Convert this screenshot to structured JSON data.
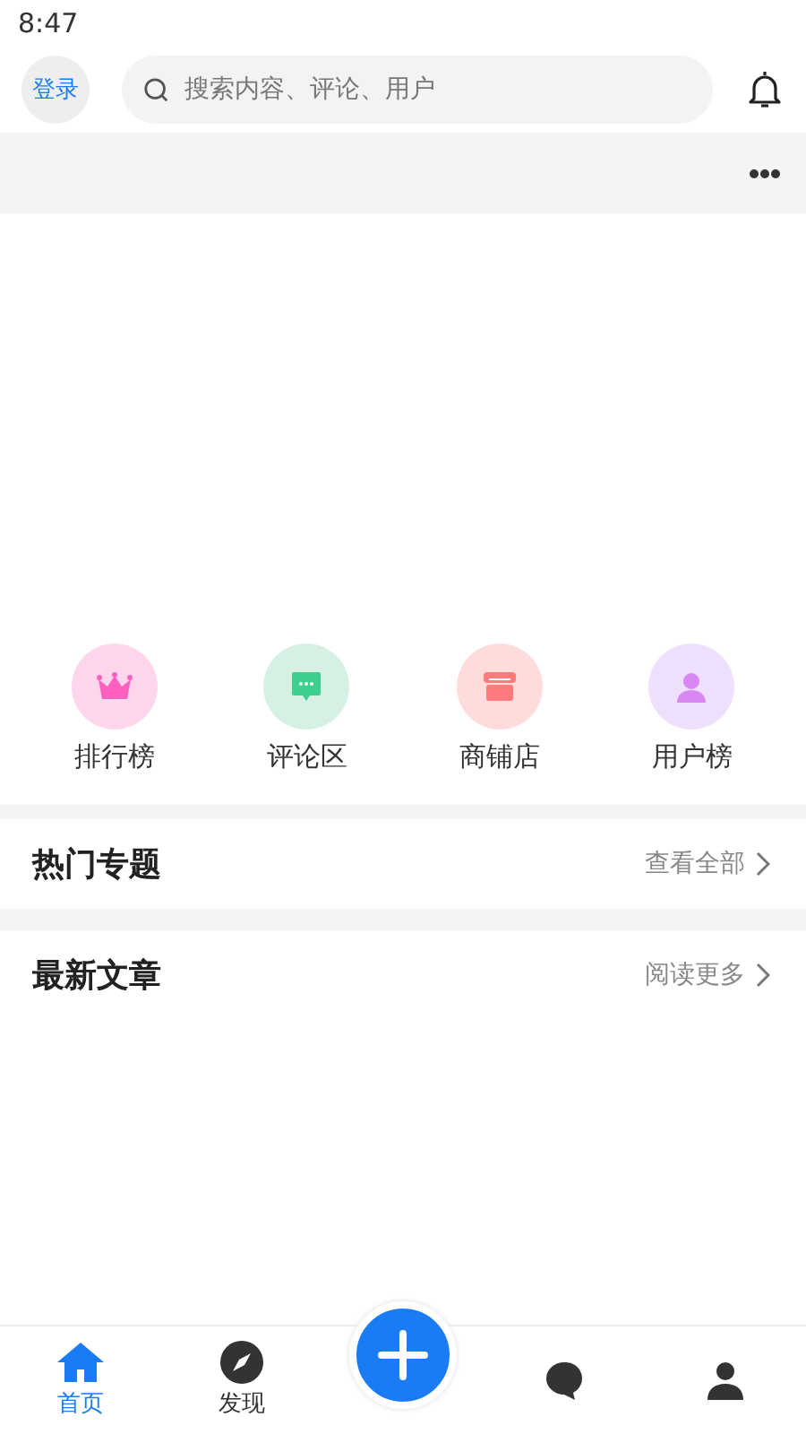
{
  "status_bar": {
    "time": "8:47"
  },
  "header": {
    "login": "登录",
    "search": {
      "placeholder": "搜索内容、评论、用户"
    }
  },
  "shortcuts": [
    {
      "kind": "crown",
      "label": "排行榜",
      "color": "#ffd6ec"
    },
    {
      "kind": "comment",
      "label": "评论区",
      "color": "#d6f0e3"
    },
    {
      "kind": "shop",
      "label": "商铺店",
      "color": "#ffdcdc"
    },
    {
      "kind": "user",
      "label": "用户榜",
      "color": "#f0e0ff"
    }
  ],
  "sections": [
    {
      "title": "热门专题",
      "link": "查看全部"
    },
    {
      "title": "最新文章",
      "link": "阅读更多"
    }
  ],
  "tab_bar": [
    {
      "kind": "home",
      "label": "首页",
      "selected": true
    },
    {
      "kind": "compass",
      "label": "发现",
      "selected": false
    },
    {
      "kind": "add",
      "selected": false
    },
    {
      "kind": "chat",
      "selected": false
    },
    {
      "kind": "user",
      "selected": false
    }
  ]
}
